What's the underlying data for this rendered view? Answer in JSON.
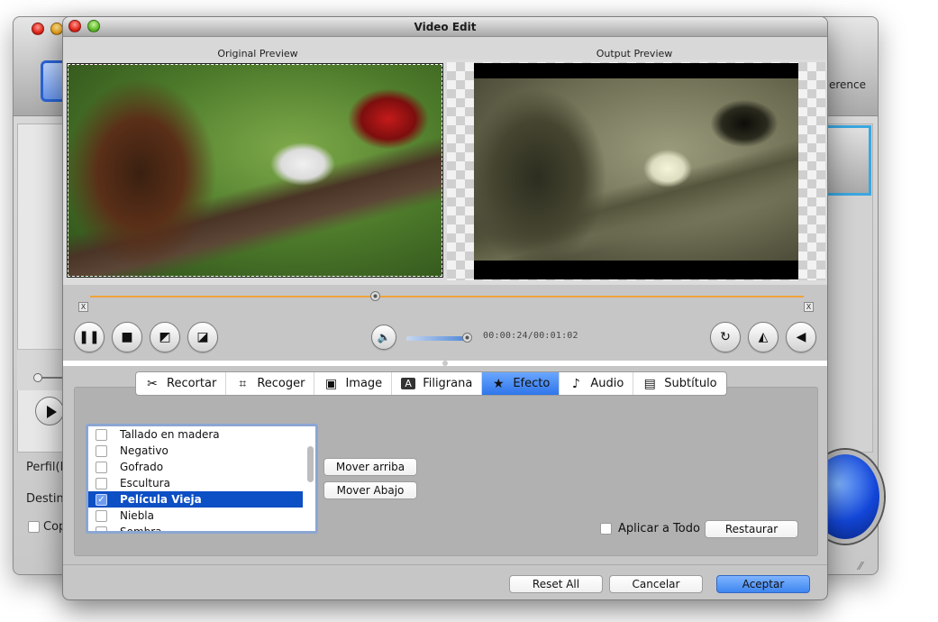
{
  "background_window": {
    "preference_label": "erence",
    "labels": {
      "profile": "Perfil(F",
      "destination": "Destin",
      "copy": "Cop"
    }
  },
  "dialog": {
    "title": "Video Edit",
    "original_preview_label": "Original Preview",
    "output_preview_label": "Output Preview",
    "playback": {
      "position_fraction": 0.4,
      "trim_start_label": "X",
      "trim_end_label": "X",
      "volume_fraction": 1.0,
      "time_readout": "00:00:24/00:01:02"
    },
    "tabs": [
      {
        "label": "Recortar",
        "icon": "scissors-icon",
        "glyph": "✂",
        "active": false
      },
      {
        "label": "Recoger",
        "icon": "crop-icon",
        "glyph": "⌗",
        "active": false
      },
      {
        "label": "Image",
        "icon": "image-icon",
        "glyph": "▣",
        "active": false
      },
      {
        "label": "Filigrana",
        "icon": "watermark-icon",
        "glyph": "A",
        "active": false
      },
      {
        "label": "Efecto",
        "icon": "star-icon",
        "glyph": "★",
        "active": true
      },
      {
        "label": "Audio",
        "icon": "music-note-icon",
        "glyph": "♪",
        "active": false
      },
      {
        "label": "Subtítulo",
        "icon": "subtitle-icon",
        "glyph": "▤",
        "active": false
      }
    ],
    "effects": [
      {
        "label": "Tallado en madera",
        "checked": false,
        "selected": false
      },
      {
        "label": "Negativo",
        "checked": false,
        "selected": false
      },
      {
        "label": "Gofrado",
        "checked": false,
        "selected": false
      },
      {
        "label": "Escultura",
        "checked": false,
        "selected": false
      },
      {
        "label": "Película Vieja",
        "checked": true,
        "selected": true
      },
      {
        "label": "Niebla",
        "checked": false,
        "selected": false
      },
      {
        "label": "Sombra",
        "checked": false,
        "selected": false
      }
    ],
    "move_up_label": "Mover arriba",
    "move_down_label": "Mover Abajo",
    "apply_all_label": "Aplicar a Todo",
    "apply_all_checked": false,
    "restore_label": "Restaurar",
    "reset_all_label": "Reset All",
    "cancel_label": "Cancelar",
    "accept_label": "Aceptar"
  }
}
